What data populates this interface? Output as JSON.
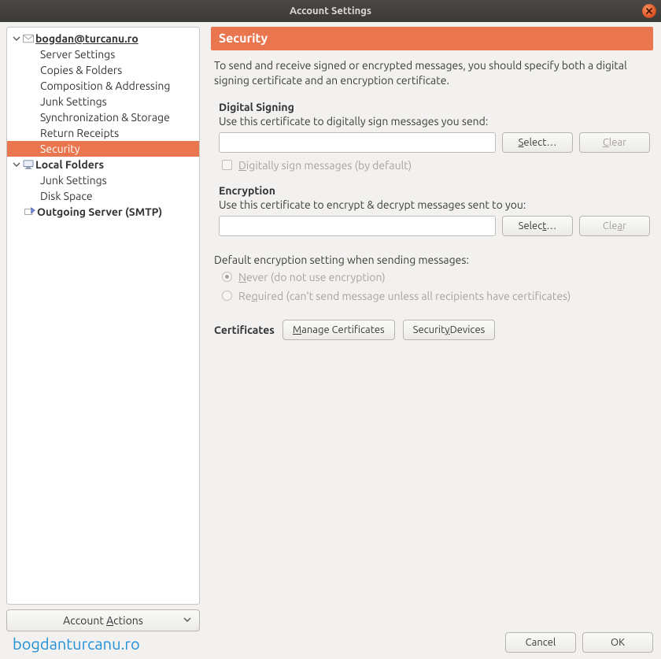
{
  "window": {
    "title": "Account Settings"
  },
  "sidebar": {
    "account_email": "bogdan@turcanu.ro",
    "items": [
      "Server Settings",
      "Copies & Folders",
      "Composition & Addressing",
      "Junk Settings",
      "Synchronization & Storage",
      "Return Receipts",
      "Security"
    ],
    "local_folders_label": "Local Folders",
    "local_items": [
      "Junk Settings",
      "Disk Space"
    ],
    "smtp_label": "Outgoing Server (SMTP)",
    "actions_label_pre": "Account ",
    "actions_label_u": "A",
    "actions_label_post": "ctions"
  },
  "panel": {
    "title": "Security",
    "intro": "To send and receive signed or encrypted messages, you should specify both a digital signing certificate and an encryption certificate.",
    "signing": {
      "title": "Digital Signing",
      "desc": "Use this certificate to digitally sign messages you send:",
      "value": "",
      "select_u": "S",
      "select_rest": "elect…",
      "clear_u": "C",
      "clear_rest": "lear",
      "default_check_pre": "",
      "default_check_u": "D",
      "default_check_post": "igitally sign messages (by default)"
    },
    "encryption": {
      "title": "Encryption",
      "desc": "Use this certificate to encrypt & decrypt messages sent to you:",
      "value": "",
      "select_pre": "Selec",
      "select_u": "t",
      "select_post": "…",
      "clear_pre": "Cle",
      "clear_u": "a",
      "clear_post": "r",
      "default_label": "Default encryption setting when sending messages:",
      "opt_never_u": "N",
      "opt_never_post": "ever (do not use encryption)",
      "opt_required_pre": "Re",
      "opt_required_u": "q",
      "opt_required_post": "uired (can't send message unless all recipients have certificates)"
    },
    "certs": {
      "title": "Certificates",
      "manage_u": "M",
      "manage_rest": "anage Certificates",
      "devices_pre": "Securit",
      "devices_u": "y",
      "devices_post": " Devices"
    }
  },
  "buttons": {
    "cancel": "Cancel",
    "ok": "OK"
  },
  "watermark": "bogdanturcanu.ro"
}
